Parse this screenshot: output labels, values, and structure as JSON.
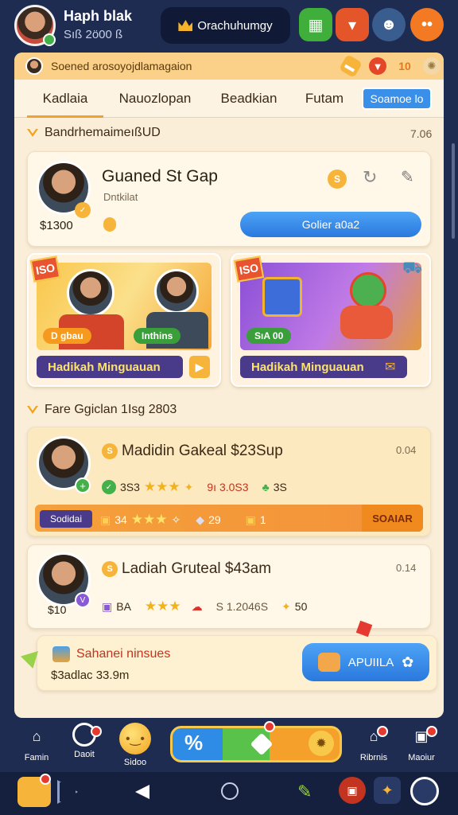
{
  "header": {
    "user_name": "Haph blak",
    "user_sub": "Sıß 2ö00 ß",
    "title": "Orachuhumgy",
    "icons": [
      "gift-icon",
      "chest-icon",
      "smile-icon",
      "more-icon"
    ]
  },
  "notice": {
    "text": "Soened arosoyojdlamagaion",
    "count": "10"
  },
  "tabs": {
    "items": [
      "Kadlaia",
      "Nauozlopan",
      "Beadkian",
      "Futam"
    ],
    "active": "Kadlaia",
    "search_label": "Soamoe lo"
  },
  "section1": {
    "title": "BandrhemaimeıßUD",
    "meta": "7.06"
  },
  "profile_card": {
    "name": "Guaned St Gap",
    "sub": "Dntkilat",
    "amount": "$1300",
    "button": "Golier a0a2"
  },
  "promos": [
    {
      "tag": "ISO",
      "chip": "D gbau",
      "chip2": "Inthins",
      "label": "Hadikah Minguauan"
    },
    {
      "tag": "ISO",
      "chip": "SıA 00",
      "label": "Hadikah Minguauan"
    }
  ],
  "section2": {
    "title": "Fare Ggiclan 1Isg 2803"
  },
  "list": [
    {
      "title": "Madidin Gakeal $23Sup",
      "time": "0.04",
      "row": {
        "a": "3S3",
        "b": "9ı 3.0S3",
        "c": "3S"
      },
      "bar": {
        "pill": "Sodidai",
        "a": "34",
        "b": "29",
        "c": "1",
        "end": "SOAIAR"
      }
    },
    {
      "title": "Ladiah Gruteal $43am",
      "time": "0.14",
      "amount": "$10",
      "row": {
        "a": "BA",
        "b": "S 1.2046S",
        "c": "50"
      }
    }
  ],
  "bottom_banner": {
    "title": "Sahanei ninsues",
    "sub": "$3adlac 33.9m",
    "button": "APUIILA"
  },
  "nav": {
    "items": [
      "Famin",
      "Daoit",
      "Sidoo",
      "Ribrnis",
      "Maoiur"
    ],
    "center_label": "%"
  },
  "colors": {
    "background": "#1e2c52",
    "panel": "#fbeed9",
    "accent_orange": "#f0a22a",
    "accent_blue": "#2a79de",
    "promo_purple": "#4a3a8a"
  }
}
